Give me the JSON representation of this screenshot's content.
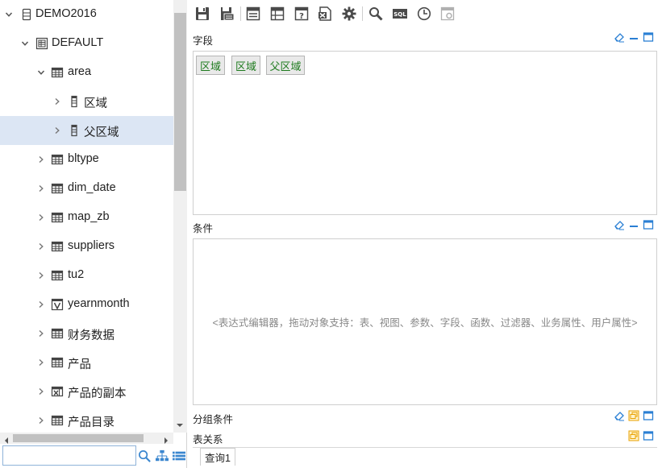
{
  "tree": {
    "nodes": [
      {
        "label": "DEMO2016",
        "level": 0,
        "expanded": true,
        "icon": "database-icon",
        "name": "tree-node-demo2016"
      },
      {
        "label": "DEFAULT",
        "level": 1,
        "expanded": true,
        "icon": "schema-icon",
        "name": "tree-node-default"
      },
      {
        "label": "area",
        "level": 2,
        "expanded": true,
        "icon": "table-icon",
        "name": "tree-node-area"
      },
      {
        "label": "区域",
        "level": 3,
        "expanded": false,
        "icon": "field-icon",
        "name": "tree-node-area-region"
      },
      {
        "label": "父区域",
        "level": 3,
        "expanded": false,
        "icon": "field-icon",
        "name": "tree-node-area-parent-region",
        "selected": true
      },
      {
        "label": "bltype",
        "level": 2,
        "expanded": false,
        "icon": "table-icon",
        "name": "tree-node-bltype"
      },
      {
        "label": "dim_date",
        "level": 2,
        "expanded": false,
        "icon": "table-icon",
        "name": "tree-node-dim-date"
      },
      {
        "label": "map_zb",
        "level": 2,
        "expanded": false,
        "icon": "table-icon",
        "name": "tree-node-map-zb"
      },
      {
        "label": "suppliers",
        "level": 2,
        "expanded": false,
        "icon": "table-icon",
        "name": "tree-node-suppliers"
      },
      {
        "label": "tu2",
        "level": 2,
        "expanded": false,
        "icon": "table-icon",
        "name": "tree-node-tu2"
      },
      {
        "label": "yearnmonth",
        "level": 2,
        "expanded": false,
        "icon": "view-icon",
        "name": "tree-node-yearnmonth"
      },
      {
        "label": "财务数据",
        "level": 2,
        "expanded": false,
        "icon": "table-icon",
        "name": "tree-node-finance-data"
      },
      {
        "label": "产品",
        "level": 2,
        "expanded": false,
        "icon": "table-icon",
        "name": "tree-node-product"
      },
      {
        "label": "产品的副本",
        "level": 2,
        "expanded": false,
        "icon": "excel-table-icon",
        "name": "tree-node-product-copy"
      },
      {
        "label": "产品目录",
        "level": 2,
        "expanded": false,
        "icon": "table-icon",
        "name": "tree-node-product-catalog"
      }
    ]
  },
  "search": {
    "value": "",
    "placeholder": ""
  },
  "toolbar": {
    "buttons": [
      {
        "name": "save-button",
        "icon": "save-icon"
      },
      {
        "name": "save-as-button",
        "icon": "save-as-icon"
      },
      {
        "name": "table-layout-button",
        "icon": "table-layout-icon"
      },
      {
        "name": "grid-layout-button",
        "icon": "grid-layout-icon"
      },
      {
        "name": "parameter-button",
        "icon": "parameter-icon"
      },
      {
        "name": "export-excel-button",
        "icon": "excel-icon"
      },
      {
        "name": "settings-button",
        "icon": "gear-icon"
      },
      {
        "name": "search-button",
        "icon": "magnifier-icon"
      },
      {
        "name": "sql-button",
        "icon": "sql-icon",
        "label": "SQL"
      },
      {
        "name": "schedule-button",
        "icon": "clock-icon"
      },
      {
        "name": "properties-button",
        "icon": "properties-icon"
      }
    ]
  },
  "fields_section": {
    "title": "字段",
    "chips": [
      "区域",
      "区域",
      "父区域"
    ]
  },
  "conditions_section": {
    "title": "条件",
    "hint": "<表达式编辑器，拖动对象支持：表、视图、参数、字段、函数、过滤器、业务属性、用户属性>"
  },
  "group_section": {
    "title": "分组条件"
  },
  "relations_section": {
    "title": "表关系"
  },
  "tabs": {
    "query": "查询1"
  },
  "colors": {
    "accent": "#2a7fd4",
    "chip_text": "#1d7a1d",
    "selected_row": "#dce6f4",
    "restore_icon": "#e8a200"
  }
}
